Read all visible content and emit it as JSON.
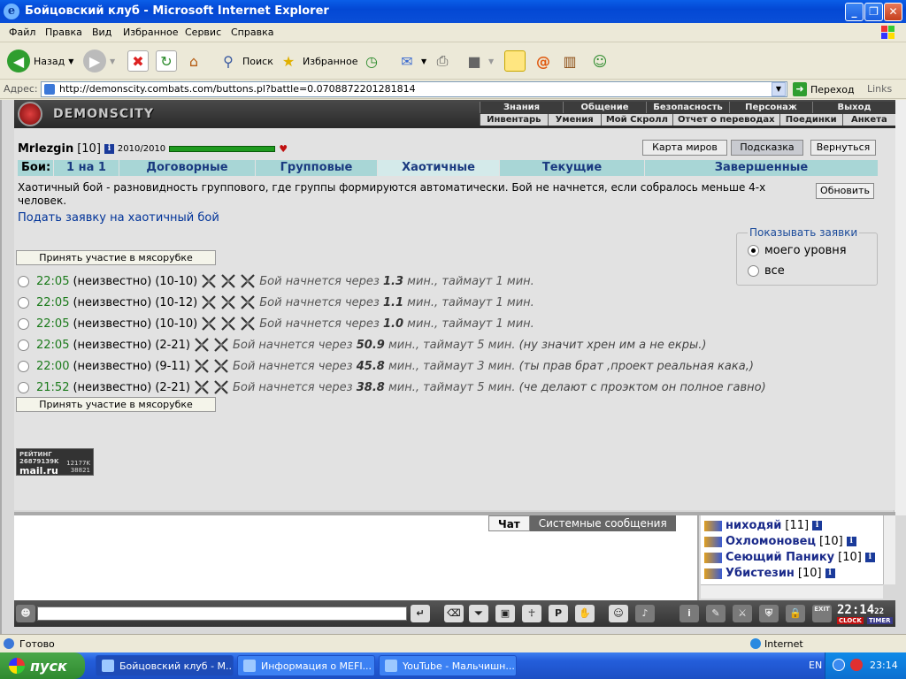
{
  "window": {
    "title": "Бойцовский клуб - Microsoft Internet Explorer"
  },
  "menu": [
    "Файл",
    "Правка",
    "Вид",
    "Избранное",
    "Сервис",
    "Справка"
  ],
  "toolbar": {
    "back": "Назад",
    "search": "Поиск",
    "favorites": "Избранное"
  },
  "address": {
    "label": "Адрес:",
    "url": "http://demonscity.combats.com/buttons.pl?battle=0.0708872201281814",
    "go": "Переход",
    "links": "Links"
  },
  "game": {
    "logo_text": "DEMONSCITY",
    "nav_top": [
      "Знания",
      "Общение",
      "Безопасность",
      "Персонаж",
      "Выход"
    ],
    "nav_bottom": [
      "Инвентарь",
      "Умения",
      "Мой Скролл",
      "Отчет о переводах",
      "Поединки",
      "Анкета"
    ]
  },
  "player": {
    "nick": "Mrlezgin",
    "level": "[10]",
    "hp": "2010/2010",
    "hp_fraction": 1.0
  },
  "top_buttons": [
    "Карта миров",
    "Подсказка",
    "Вернуться"
  ],
  "tabs": {
    "label": "Бои:",
    "items": [
      "1 на 1",
      "Договорные",
      "Групповые",
      "Хаотичные",
      "Текущие",
      "Завершенные"
    ],
    "active": 3
  },
  "description": "Хаотичный бой - разновидность группового, где группы формируются автоматически. Бой не начнется, если собралось меньше 4-х человек.",
  "refresh_label": "Обновить",
  "apply_link": "Подать заявку на хаотичный бой",
  "join_button": "Принять участие в мясорубке",
  "show_requests": {
    "title": "Показывать заявки",
    "options": [
      "моего уровня",
      "все"
    ],
    "selected": 0
  },
  "bouts": [
    {
      "time": "22:05",
      "who": "(неизвестно)",
      "range": "(10-10)",
      "wait_pre": "Бой начнется через",
      "mins": "1.3",
      "wait_post": "мин., таймаут 1 мин.",
      "note": "",
      "icons": 3
    },
    {
      "time": "22:05",
      "who": "(неизвестно)",
      "range": "(10-12)",
      "wait_pre": "Бой начнется через",
      "mins": "1.1",
      "wait_post": "мин., таймаут 1 мин.",
      "note": "",
      "icons": 3
    },
    {
      "time": "22:05",
      "who": "(неизвестно)",
      "range": "(10-10)",
      "wait_pre": "Бой начнется через",
      "mins": "1.0",
      "wait_post": "мин., таймаут 1 мин.",
      "note": "",
      "icons": 3
    },
    {
      "time": "22:05",
      "who": "(неизвестно)",
      "range": "(2-21)",
      "wait_pre": "Бой начнется через",
      "mins": "50.9",
      "wait_post": "мин., таймаут 5 мин.",
      "note": "(ну значит хрен им а не екры.)",
      "icons": 2
    },
    {
      "time": "22:00",
      "who": "(неизвестно)",
      "range": "(9-11)",
      "wait_pre": "Бой начнется через",
      "mins": "45.8",
      "wait_post": "мин., таймаут 3 мин.",
      "note": "(ты прав брат ,проект реальная кака,)",
      "icons": 2
    },
    {
      "time": "21:52",
      "who": "(неизвестно)",
      "range": "(2-21)",
      "wait_pre": "Бой начнется через",
      "mins": "38.8",
      "wait_post": "мин., таймаут 5 мин.",
      "note": "(че делают с проэктом он полное гавно)",
      "icons": 2
    }
  ],
  "rating": {
    "line1": "РЕЙТИНГ 26879139K",
    "brand": "mail.ru",
    "n1": "12177K",
    "n2": "38821"
  },
  "chat": {
    "tab_chat": "Чат",
    "tab_system": "Системные сообщения"
  },
  "users": [
    {
      "name": "ниходяй",
      "level": "[11]"
    },
    {
      "name": "Охломоновец",
      "level": "[10]"
    },
    {
      "name": "Сеющий Панику",
      "level": "[10]"
    },
    {
      "name": "Убистезин",
      "level": "[10]"
    }
  ],
  "clock": {
    "hh_mm": "22:14",
    "ss": "22",
    "label_clock": "CLOCK",
    "label_timer": "TIMER",
    "exit": "EXIT"
  },
  "status": {
    "text": "Готово",
    "zone": "Internet"
  },
  "taskbar": {
    "start": "пуск",
    "tasks": [
      "Бойцовский клуб - M...",
      "Информация о MEFI...",
      "YouTube - Мальчишн..."
    ],
    "lang": "EN",
    "time": "23:14"
  }
}
